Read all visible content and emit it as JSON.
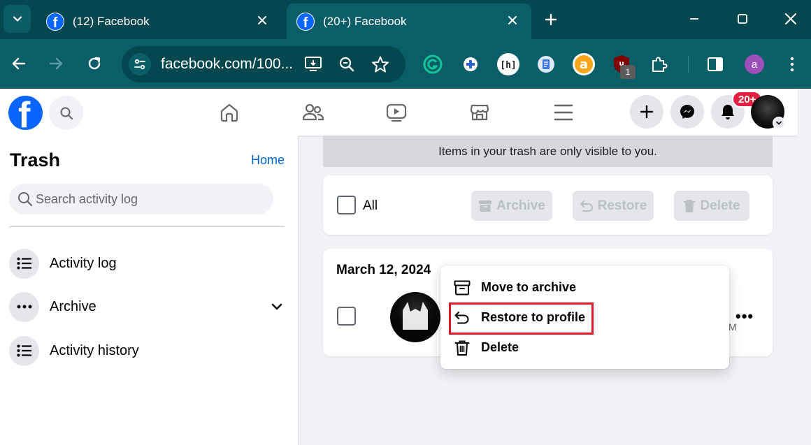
{
  "browser": {
    "tabs": [
      {
        "title": "(12) Facebook",
        "active": false
      },
      {
        "title": "(20+) Facebook",
        "active": true
      }
    ],
    "url": "facebook.com/100...",
    "extensions_badge": "1",
    "profile_initial": "a"
  },
  "fb_nav": {
    "notification_badge": "20+"
  },
  "sidebar": {
    "title": "Trash",
    "home_link": "Home",
    "search_placeholder": "Search activity log",
    "items": [
      {
        "label": "Activity log",
        "icon": "list-icon"
      },
      {
        "label": "Archive",
        "icon": "more-dots-icon"
      },
      {
        "label": "Activity history",
        "icon": "list-icon"
      }
    ]
  },
  "main": {
    "notice": "Items in your trash are only visible to you.",
    "bulk": {
      "all_label": "All",
      "archive_label": "Archive",
      "restore_label": "Restore",
      "delete_label": "Delete"
    },
    "group": {
      "date": "March 12, 2024",
      "time_fragment": "M",
      "more": "•••"
    }
  },
  "context_menu": {
    "items": [
      {
        "label": "Move to archive",
        "icon": "archive-box-icon"
      },
      {
        "label": "Restore to profile",
        "icon": "restore-arrow-icon"
      },
      {
        "label": "Delete",
        "icon": "trash-icon"
      }
    ],
    "highlighted_index": 1
  },
  "colors": {
    "chrome_dark": "#05474f",
    "chrome": "#0a5e67",
    "facebook_blue": "#0866ff",
    "highlight_red": "#e3192b"
  }
}
